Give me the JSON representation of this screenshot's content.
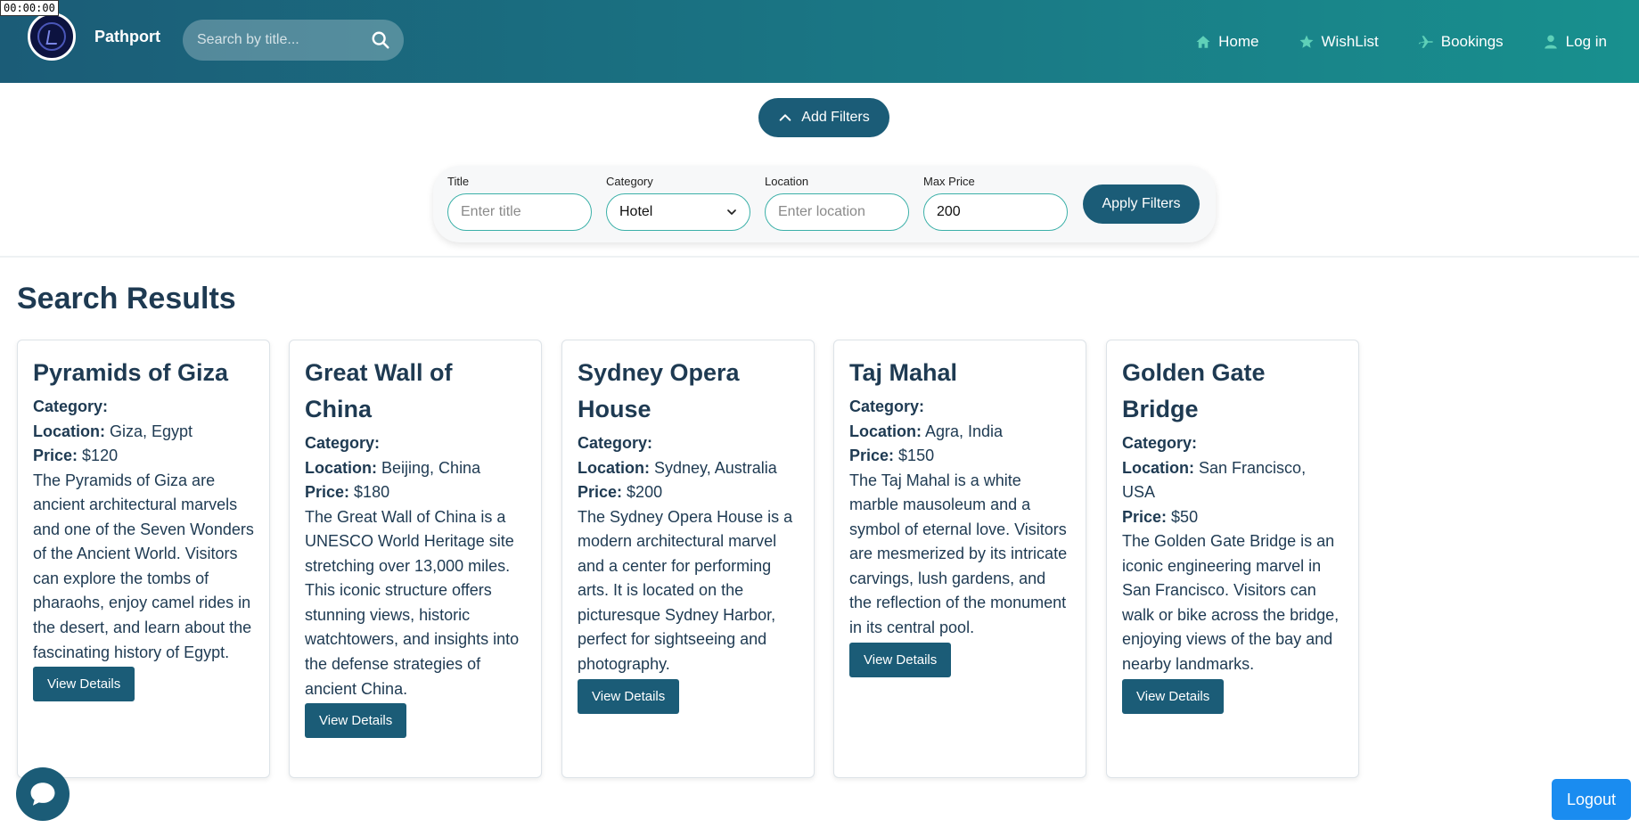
{
  "timer": "00:00:00",
  "navbar": {
    "brand": "Pathport",
    "search_placeholder": "Search by title...",
    "links": [
      {
        "label": "Home",
        "icon": "home-icon"
      },
      {
        "label": "WishList",
        "icon": "star-icon"
      },
      {
        "label": "Bookings",
        "icon": "plane-icon"
      },
      {
        "label": "Log in",
        "icon": "user-icon"
      }
    ]
  },
  "filters": {
    "toggle_label": "Add Filters",
    "title_label": "Title",
    "title_placeholder": "Enter title",
    "category_label": "Category",
    "category_value": "Hotel",
    "location_label": "Location",
    "location_placeholder": "Enter location",
    "maxprice_label": "Max Price",
    "maxprice_value": "200",
    "apply_label": "Apply Filters"
  },
  "results": {
    "heading": "Search Results",
    "category_label": "Category:",
    "location_label": "Location:",
    "price_label": "Price:",
    "view_label": "View Details",
    "cards": [
      {
        "title": "Pyramids of Giza",
        "location": "Giza, Egypt",
        "price": "$120",
        "description": "The Pyramids of Giza are ancient architectural marvels and one of the Seven Wonders of the Ancient World. Visitors can explore the tombs of pharaohs, enjoy camel rides in the desert, and learn about the fascinating history of Egypt."
      },
      {
        "title": "Great Wall of China",
        "location": "Beijing, China",
        "price": "$180",
        "description": "The Great Wall of China is a UNESCO World Heritage site stretching over 13,000 miles. This iconic structure offers stunning views, historic watchtowers, and insights into the defense strategies of ancient China."
      },
      {
        "title": "Sydney Opera House",
        "location": "Sydney, Australia",
        "price": "$200",
        "description": "The Sydney Opera House is a modern architectural marvel and a center for performing arts. It is located on the picturesque Sydney Harbor, perfect for sightseeing and photography."
      },
      {
        "title": "Taj Mahal",
        "location": "Agra, India",
        "price": "$150",
        "description": "The Taj Mahal is a white marble mausoleum and a symbol of eternal love. Visitors are mesmerized by its intricate carvings, lush gardens, and the reflection of the monument in its central pool."
      },
      {
        "title": "Golden Gate Bridge",
        "location": "San Francisco, USA",
        "price": "$50",
        "description": "The Golden Gate Bridge is an iconic engineering marvel in San Francisco. Visitors can walk or bike across the bridge, enjoying views of the bay and nearby landmarks."
      }
    ]
  },
  "logout_label": "Logout",
  "colors": {
    "primary": "#1b5c77",
    "accent": "#3bb0a8",
    "logout": "#1a8cf0"
  }
}
